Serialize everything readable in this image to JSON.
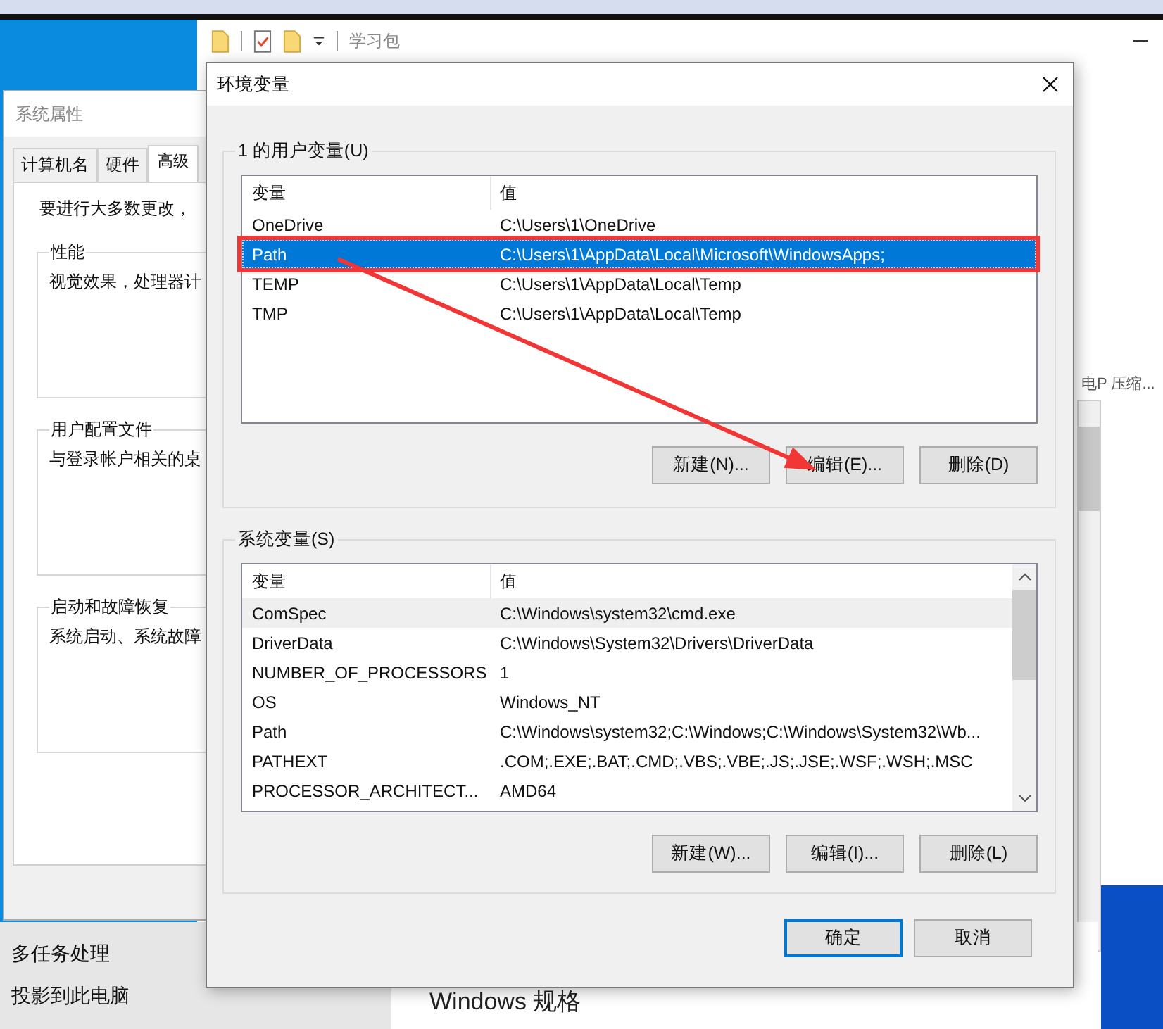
{
  "explorer": {
    "path_label": "学习包",
    "side_text": "电P 压缩..."
  },
  "system_properties": {
    "title": "系统属性",
    "tabs": [
      {
        "label": "计算机名",
        "selected": false
      },
      {
        "label": "硬件",
        "selected": false
      },
      {
        "label": "高级",
        "selected": true
      }
    ],
    "intro": "要进行大多数更改，",
    "groups": [
      {
        "title": "性能",
        "text": "视觉效果，处理器计"
      },
      {
        "title": "用户配置文件",
        "text": "与登录帐户相关的桌"
      },
      {
        "title": "启动和故障恢复",
        "text": "系统启动、系统故障"
      }
    ]
  },
  "settings": {
    "nav": [
      "多任务处理",
      "投影到此电脑"
    ],
    "heading": "Windows 规格"
  },
  "dialog": {
    "title": "环境变量",
    "user_group": {
      "label": "1 的用户变量(U)",
      "columns": [
        "变量",
        "值"
      ],
      "rows": [
        {
          "name": "OneDrive",
          "value": "C:\\Users\\1\\OneDrive",
          "selected": false,
          "hovered": false
        },
        {
          "name": "Path",
          "value": "C:\\Users\\1\\AppData\\Local\\Microsoft\\WindowsApps;",
          "selected": true,
          "hovered": false
        },
        {
          "name": "TEMP",
          "value": "C:\\Users\\1\\AppData\\Local\\Temp",
          "selected": false,
          "hovered": false
        },
        {
          "name": "TMP",
          "value": "C:\\Users\\1\\AppData\\Local\\Temp",
          "selected": false,
          "hovered": false
        }
      ],
      "buttons": [
        "新建(N)...",
        "编辑(E)...",
        "删除(D)"
      ]
    },
    "system_group": {
      "label": "系统变量(S)",
      "columns": [
        "变量",
        "值"
      ],
      "rows": [
        {
          "name": "ComSpec",
          "value": "C:\\Windows\\system32\\cmd.exe",
          "selected": false,
          "hovered": true
        },
        {
          "name": "DriverData",
          "value": "C:\\Windows\\System32\\Drivers\\DriverData",
          "selected": false,
          "hovered": false
        },
        {
          "name": "NUMBER_OF_PROCESSORS",
          "value": "1",
          "selected": false,
          "hovered": false
        },
        {
          "name": "OS",
          "value": "Windows_NT",
          "selected": false,
          "hovered": false
        },
        {
          "name": "Path",
          "value": "C:\\Windows\\system32;C:\\Windows;C:\\Windows\\System32\\Wb...",
          "selected": false,
          "hovered": false
        },
        {
          "name": "PATHEXT",
          "value": ".COM;.EXE;.BAT;.CMD;.VBS;.VBE;.JS;.JSE;.WSF;.WSH;.MSC",
          "selected": false,
          "hovered": false
        },
        {
          "name": "PROCESSOR_ARCHITECT...",
          "value": "AMD64",
          "selected": false,
          "hovered": false
        }
      ],
      "buttons": [
        "新建(W)...",
        "编辑(I)...",
        "删除(L)"
      ]
    },
    "buttons": [
      {
        "label": "确定",
        "default": true
      },
      {
        "label": "取消",
        "default": false
      }
    ]
  }
}
